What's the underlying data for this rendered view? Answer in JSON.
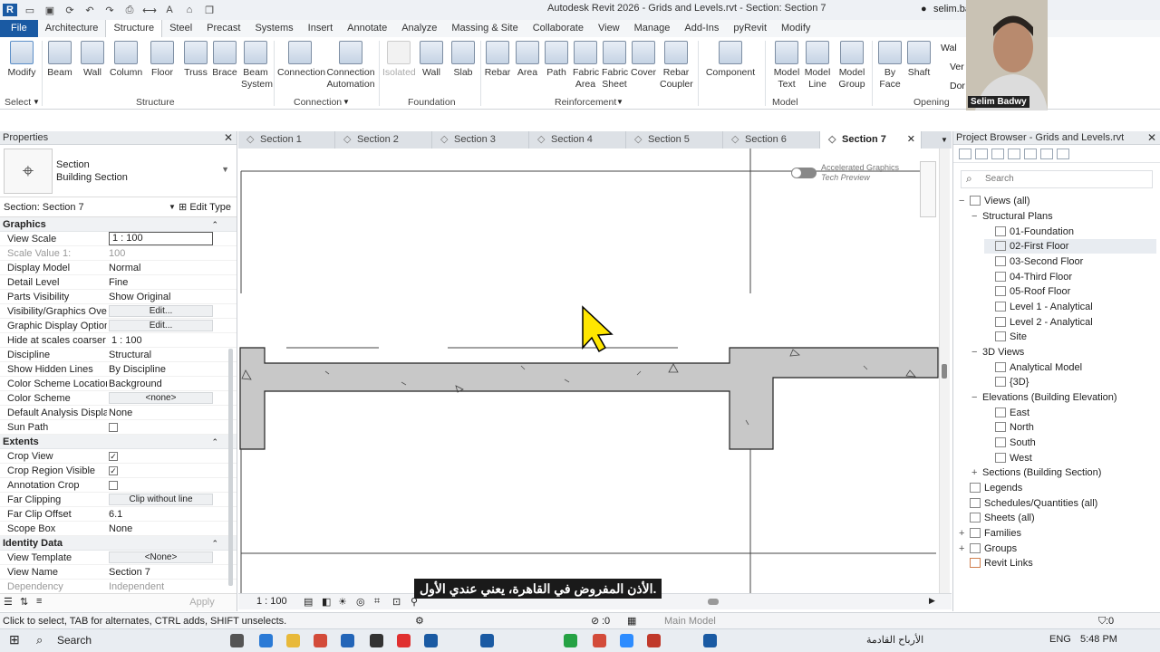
{
  "window": {
    "title": "Autodesk Revit 2026 - Grids and Levels.rvt - Section: Section 7",
    "user": "selim.ba..."
  },
  "ribbon_tabs": [
    "File",
    "Architecture",
    "Structure",
    "Steel",
    "Precast",
    "Systems",
    "Insert",
    "Annotate",
    "Analyze",
    "Massing & Site",
    "Collaborate",
    "View",
    "Manage",
    "Add-Ins",
    "pyRevit",
    "Modify"
  ],
  "ribbon": {
    "tools": {
      "modify": "Modify",
      "beam": "Beam",
      "wall": "Wall",
      "column": "Column",
      "floor": "Floor",
      "truss": "Truss",
      "brace": "Brace",
      "beam_system_1": "Beam",
      "beam_system_2": "System",
      "connection": "Connection",
      "conn_auto_1": "Connection",
      "conn_auto_2": "Automation",
      "isolated": "Isolated",
      "f_wall": "Wall",
      "slab": "Slab",
      "rebar": "Rebar",
      "area": "Area",
      "path": "Path",
      "fabric_area_1": "Fabric",
      "fabric_area_2": "Area",
      "fabric_sheet_1": "Fabric",
      "fabric_sheet_2": "Sheet",
      "cover": "Cover",
      "rebar_coupler_1": "Rebar",
      "rebar_coupler_2": "Coupler",
      "component": "Component",
      "model_text_1": "Model",
      "model_text_2": "Text",
      "model_line_1": "Model",
      "model_line_2": "Line",
      "model_group_1": "Model",
      "model_group_2": "Group",
      "by_face_1": "By",
      "by_face_2": "Face",
      "shaft": "Shaft",
      "op_wall": "Wal",
      "op_vert": "Ver",
      "op_dormer": "Dor"
    },
    "panels": {
      "select": "Select",
      "structure": "Structure",
      "connection": "Connection",
      "foundation": "Foundation",
      "reinforcement": "Reinforcement",
      "model": "Model",
      "opening": "Opening"
    }
  },
  "properties": {
    "title": "Properties",
    "type_name_1": "Section",
    "type_name_2": "Building Section",
    "instance": "Section: Section 7",
    "edit_type": "Edit Type",
    "groups": {
      "graphics": "Graphics",
      "extents": "Extents",
      "identity": "Identity Data"
    },
    "rows": {
      "view_scale": {
        "k": "View Scale",
        "v": "1 : 100"
      },
      "scale_value": {
        "k": "Scale Value    1:",
        "v": "100"
      },
      "display_model": {
        "k": "Display Model",
        "v": "Normal"
      },
      "detail_level": {
        "k": "Detail Level",
        "v": "Fine"
      },
      "parts_visibility": {
        "k": "Parts Visibility",
        "v": "Show Original"
      },
      "vg_overrides": {
        "k": "Visibility/Graphics Over...",
        "v": "Edit..."
      },
      "gdo": {
        "k": "Graphic Display Options",
        "v": "Edit..."
      },
      "hide_scales": {
        "k": "Hide at scales coarser t...",
        "v": "1 : 100"
      },
      "discipline": {
        "k": "Discipline",
        "v": "Structural"
      },
      "hidden_lines": {
        "k": "Show Hidden Lines",
        "v": "By Discipline"
      },
      "cs_location": {
        "k": "Color Scheme Location",
        "v": "Background"
      },
      "color_scheme": {
        "k": "Color Scheme",
        "v": "<none>"
      },
      "def_analysis": {
        "k": "Default Analysis Displa...",
        "v": "None"
      },
      "sun_path": {
        "k": "Sun Path",
        "v": ""
      },
      "crop_view": {
        "k": "Crop View",
        "v": "✓"
      },
      "crop_visible": {
        "k": "Crop Region Visible",
        "v": "✓"
      },
      "annotation_crop": {
        "k": "Annotation Crop",
        "v": ""
      },
      "far_clipping": {
        "k": "Far Clipping",
        "v": "Clip without line"
      },
      "far_clip_offset": {
        "k": "Far Clip Offset",
        "v": "6.1"
      },
      "scope_box": {
        "k": "Scope Box",
        "v": "None"
      },
      "view_template": {
        "k": "View Template",
        "v": "<None>"
      },
      "view_name": {
        "k": "View Name",
        "v": "Section 7"
      },
      "dependency": {
        "k": "Dependency",
        "v": "Independent"
      }
    },
    "apply": "Apply"
  },
  "doc_tabs": [
    "Section 1",
    "Section 2",
    "Section 3",
    "Section 4",
    "Section 5",
    "Section 6",
    "Section 7"
  ],
  "canvas": {
    "accelerated_1": "Accelerated Graphics",
    "accelerated_2": "Tech Preview"
  },
  "view_control": {
    "scale": "1 : 100"
  },
  "project_browser": {
    "title": "Project Browser - Grids and Levels.rvt",
    "search_placeholder": "Search",
    "nodes": {
      "views_all": "Views (all)",
      "structural_plans": "Structural Plans",
      "p1": "01-Foundation",
      "p2": "02-First Floor",
      "p3": "03-Second Floor",
      "p4": "04-Third Floor",
      "p5": "05-Roof Floor",
      "p6": "Level 1 - Analytical",
      "p7": "Level 2 - Analytical",
      "p8": "Site",
      "views_3d": "3D Views",
      "v1": "Analytical Model",
      "v2": "{3D}",
      "elevations": "Elevations (Building Elevation)",
      "e1": "East",
      "e2": "North",
      "e3": "South",
      "e4": "West",
      "sections": "Sections (Building Section)",
      "legends": "Legends",
      "schedules": "Schedules/Quantities (all)",
      "sheets": "Sheets (all)",
      "families": "Families",
      "groups": "Groups",
      "revit_links": "Revit Links"
    }
  },
  "status": {
    "hint": "Click to select, TAB for alternates, CTRL adds, SHIFT unselects.",
    "zero": ":0",
    "workset": "Main Model",
    "filter": ":0"
  },
  "caption": ".الأذن المفروض في القاهرة، يعني عندي الأول",
  "webcam_name": "Selim Badwy",
  "taskbar": {
    "search": "Search",
    "weather": "الأرباح القادمة",
    "lang": "ENG",
    "time": "5:48 PM"
  }
}
